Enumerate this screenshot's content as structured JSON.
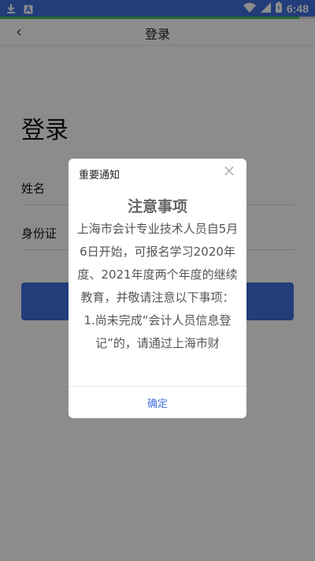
{
  "status_bar": {
    "time": "6:48",
    "icons": [
      "download-icon",
      "a-letter-icon",
      "wifi-icon",
      "signal-icon",
      "battery-icon"
    ],
    "progress": 0.95,
    "colors": {
      "background": "#3f6fdc",
      "progress": "#36c24a"
    }
  },
  "app_bar": {
    "title": "登录",
    "back_glyph": "‹"
  },
  "login": {
    "heading": "登录",
    "fields": [
      {
        "label": "姓名",
        "value": "",
        "placeholder": ""
      },
      {
        "label": "身份证",
        "value": "",
        "placeholder": ""
      }
    ],
    "button_label": "",
    "button_color": "#3f6fdc"
  },
  "dialog": {
    "title": "重要通知",
    "close_glyph": "×",
    "heading": "注意事项",
    "paragraphs": [
      "上海市会计专业技术人员自5月6日开始，可报名学习2020年度、2021年度两个年度的继续教育，并敬请注意以下事项：",
      "1.尚未完成“会计人员信息登记”的，请通过上海市财"
    ],
    "confirm_label": "确定",
    "accent_color": "#3f6fdc"
  }
}
